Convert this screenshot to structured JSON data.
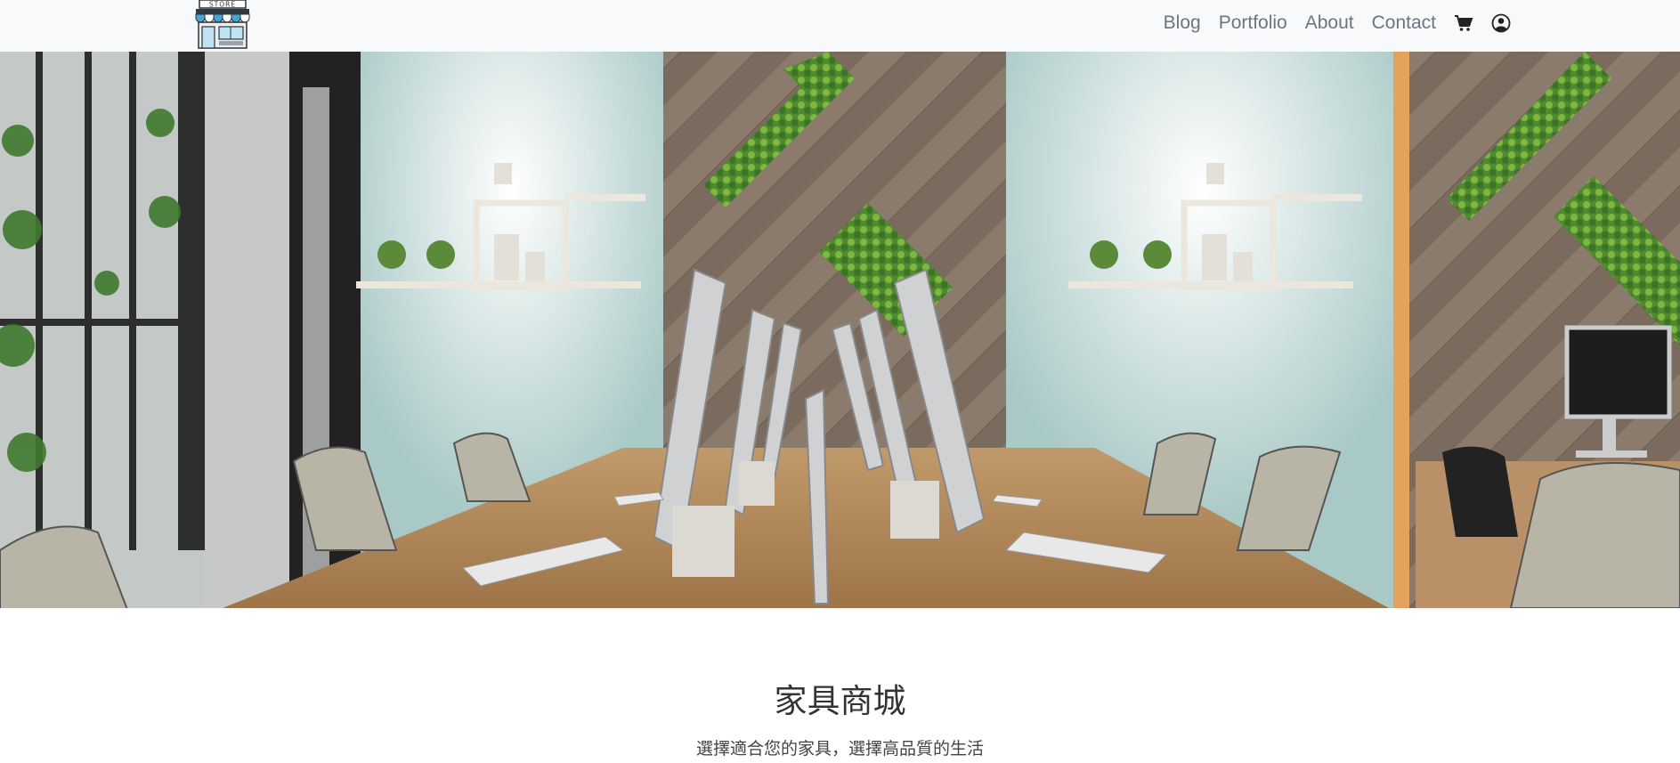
{
  "navbar": {
    "logo_text": "STORE",
    "links": [
      "Blog",
      "Portfolio",
      "About",
      "Contact"
    ],
    "icons": [
      "cart-icon",
      "user-circle-icon"
    ]
  },
  "hero": {
    "image": "office-interior-photo"
  },
  "intro": {
    "title": "家具商城",
    "subtitle": "選擇適合您的家具，選擇高品質的生活"
  },
  "colors": {
    "navbar_bg": "#f8f9fa",
    "nav_link": "#6c757d",
    "awning_blue": "#3fa7dc"
  }
}
